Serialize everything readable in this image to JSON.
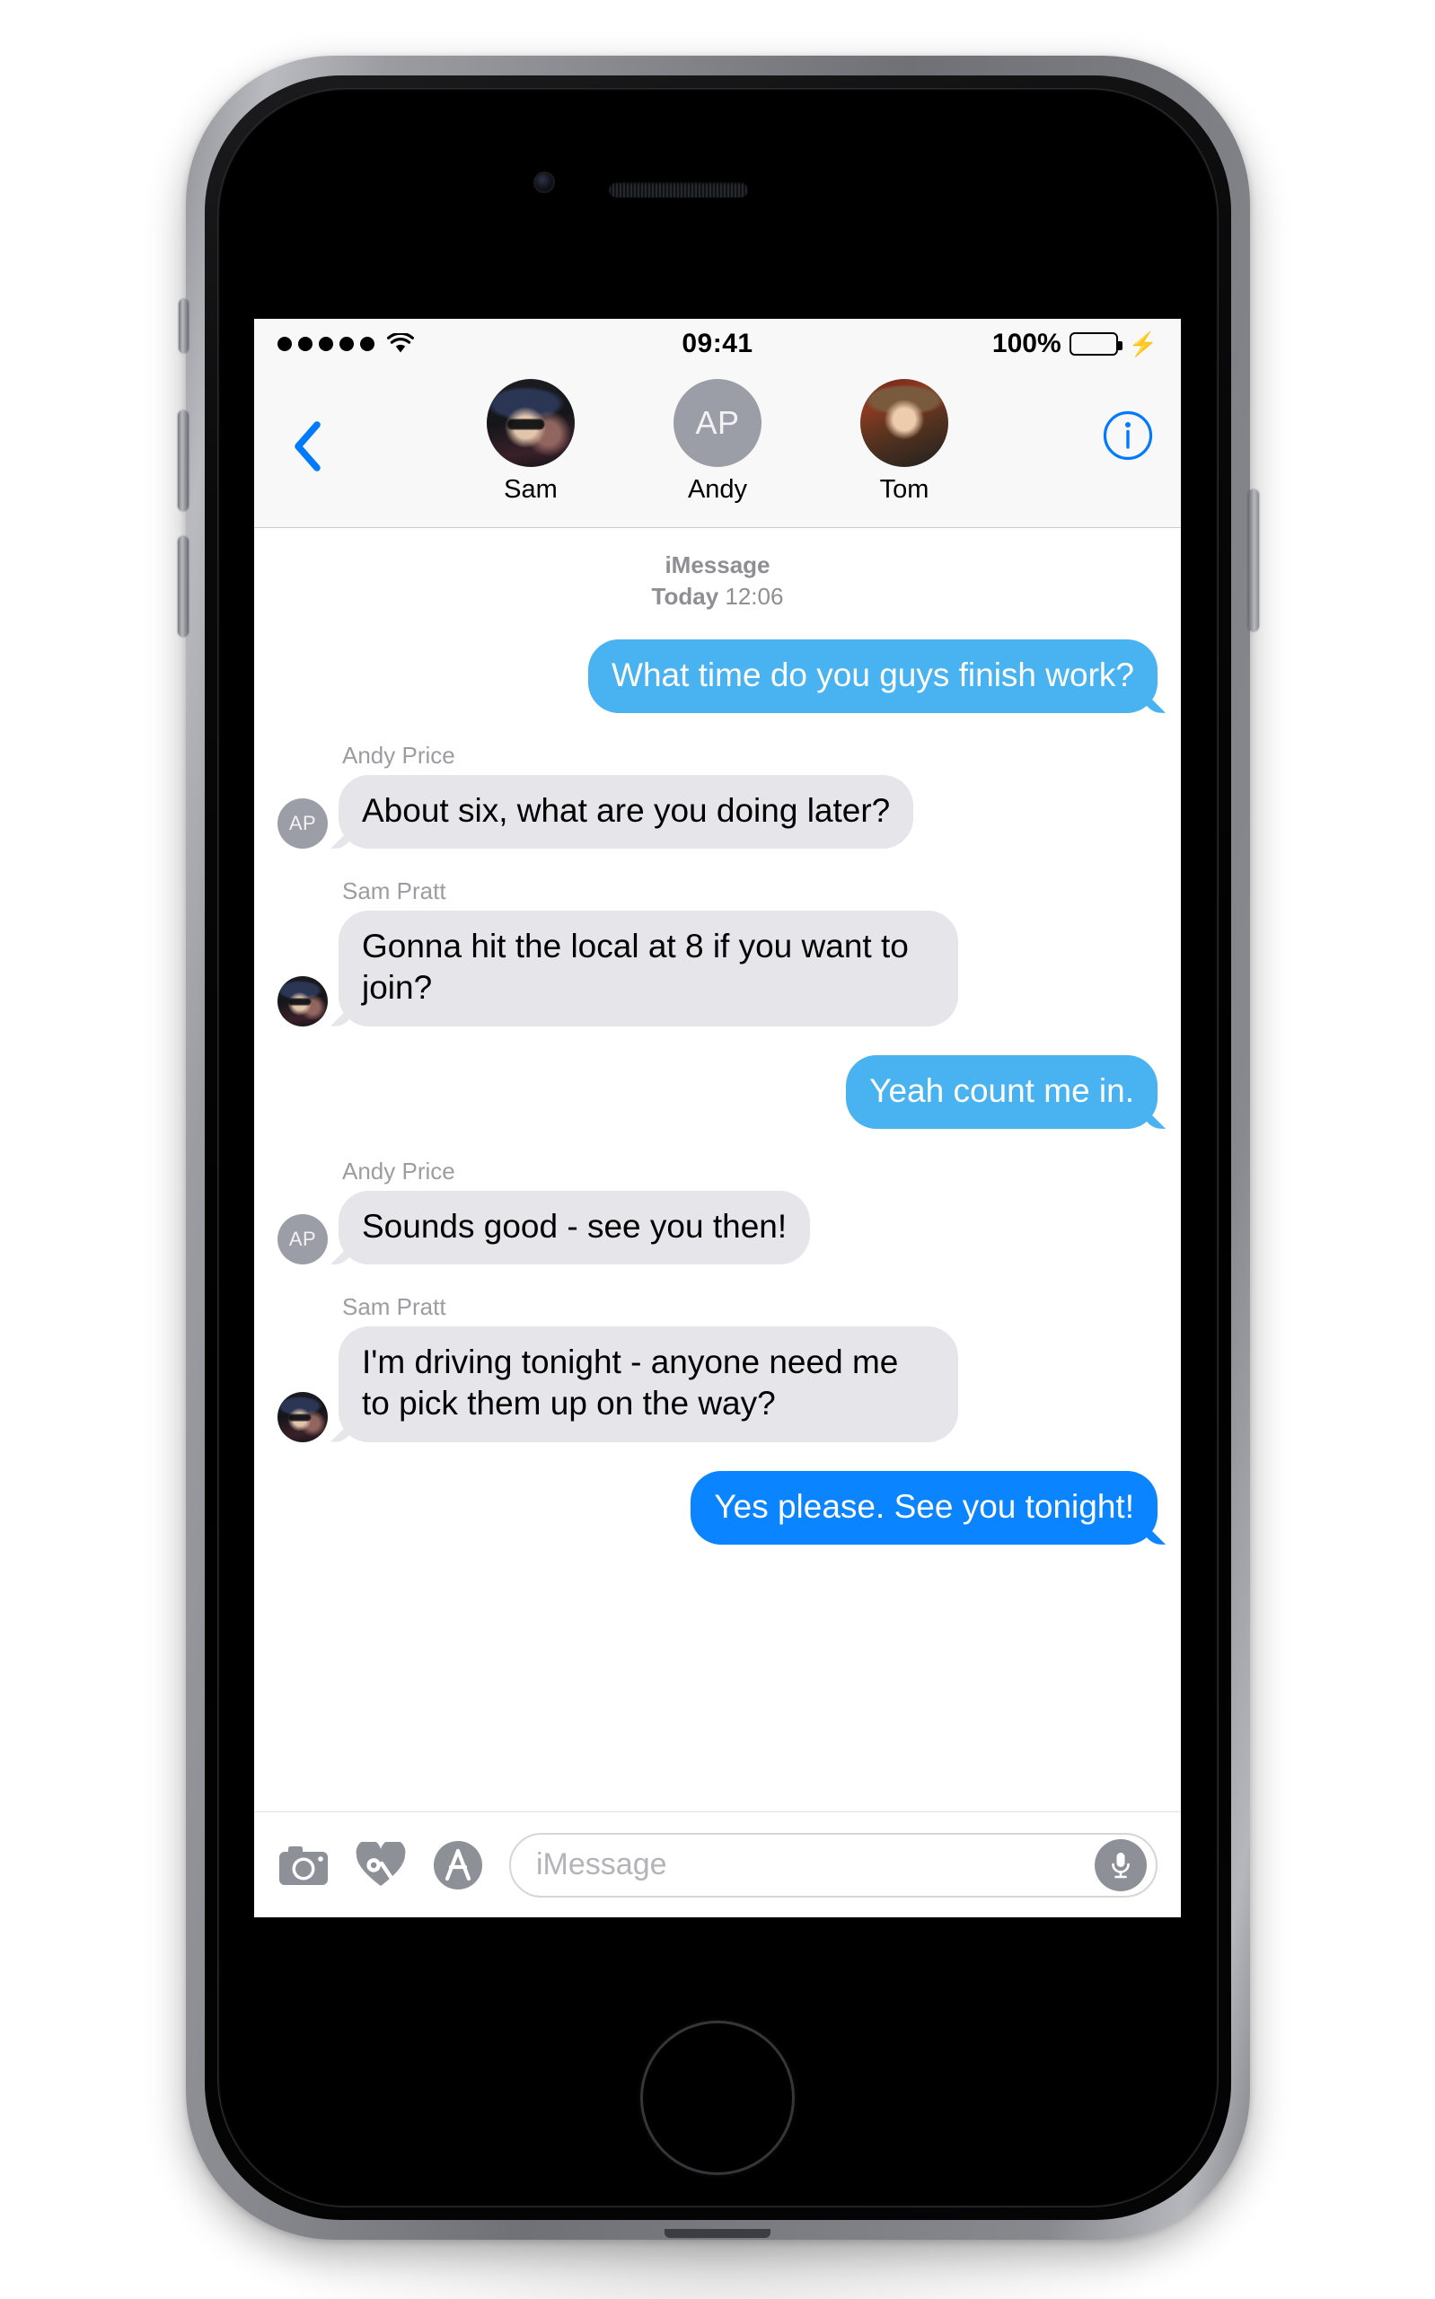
{
  "status_bar": {
    "signal_dots": 5,
    "wifi_icon": "wifi-icon",
    "time": "09:41",
    "battery_percent": "100%",
    "battery_color": "#4cd764",
    "charging_icon": "⚡"
  },
  "header": {
    "back_icon": "chevron-left-icon",
    "info_icon": "info-circle-icon",
    "accent_color": "#007aff",
    "contacts": [
      {
        "name": "Sam",
        "avatar_type": "photo",
        "initials": ""
      },
      {
        "name": "Andy",
        "avatar_type": "initials",
        "initials": "AP"
      },
      {
        "name": "Tom",
        "avatar_type": "photo",
        "initials": ""
      }
    ]
  },
  "conversation": {
    "service": "iMessage",
    "day": "Today",
    "time": "12:06",
    "messages": [
      {
        "direction": "outgoing",
        "sender": "",
        "text": "What time do you guys finish work?",
        "avatar_type": "none",
        "initials": "",
        "bubble_color": "#49b3f1"
      },
      {
        "direction": "incoming",
        "sender": "Andy Price",
        "text": "About six, what are you doing later?",
        "avatar_type": "initials",
        "initials": "AP",
        "bubble_color": "#e5e5ea"
      },
      {
        "direction": "incoming",
        "sender": "Sam Pratt",
        "text": "Gonna hit the local at 8 if you want to join?",
        "avatar_type": "photo",
        "initials": "",
        "bubble_color": "#e5e5ea"
      },
      {
        "direction": "outgoing",
        "sender": "",
        "text": "Yeah count me in.",
        "avatar_type": "none",
        "initials": "",
        "bubble_color": "#49b3f1"
      },
      {
        "direction": "incoming",
        "sender": "Andy Price",
        "text": "Sounds good - see you then!",
        "avatar_type": "initials",
        "initials": "AP",
        "bubble_color": "#e5e5ea"
      },
      {
        "direction": "incoming",
        "sender": "Sam Pratt",
        "text": "I'm driving tonight - anyone need me to pick them up on the way?",
        "avatar_type": "photo",
        "initials": "",
        "bubble_color": "#e5e5ea"
      },
      {
        "direction": "outgoing",
        "sender": "",
        "text": "Yes please. See you tonight!",
        "avatar_type": "none",
        "initials": "",
        "bubble_color": "#0b84ff"
      }
    ]
  },
  "input_bar": {
    "camera_icon": "camera-icon",
    "digital_touch_icon": "digital-touch-heart-icon",
    "app_store_icon": "app-store-icon",
    "placeholder": "iMessage",
    "mic_icon": "microphone-icon"
  }
}
